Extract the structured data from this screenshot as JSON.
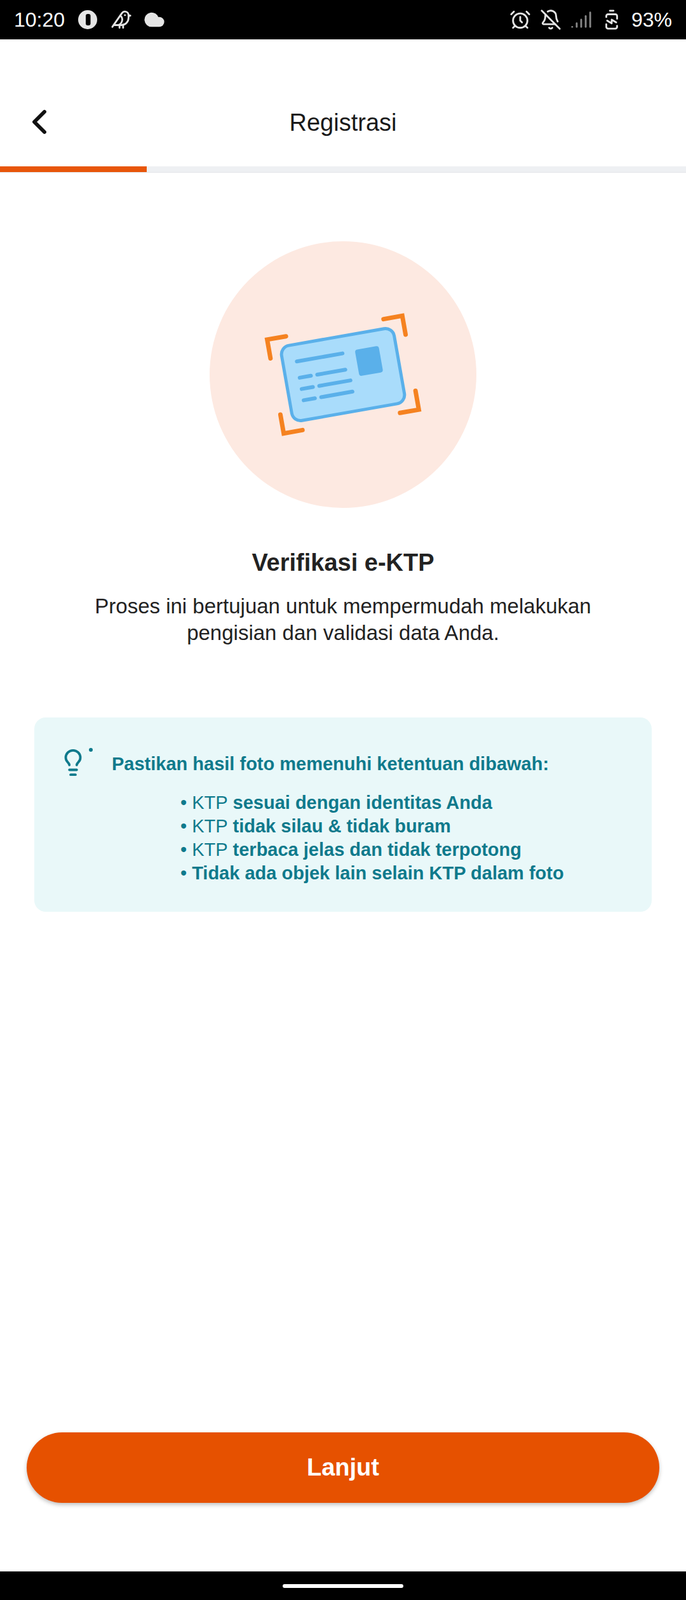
{
  "status_bar": {
    "time": "10:20",
    "battery": "93%"
  },
  "header": {
    "title": "Registrasi"
  },
  "progress": {
    "level": 0.214
  },
  "section": {
    "title": "Verifikasi e-KTP",
    "description": "Proses ini bertujuan untuk mempermudah melakukan pengisian dan validasi data Anda."
  },
  "tips": {
    "heading": "Pastikan hasil foto memenuhi ketentuan dibawah:",
    "bullet": "•",
    "items": [
      {
        "prefix": "KTP",
        "text": "sesuai dengan identitas Anda"
      },
      {
        "prefix": "KTP",
        "text": "tidak silau & tidak buram"
      },
      {
        "prefix": "KTP",
        "text": "terbaca jelas dan tidak terpotong"
      },
      {
        "prefix": "",
        "text": "Tidak ada objek lain selain KTP dalam foto"
      }
    ]
  },
  "buttons": [
    "Lanjut"
  ]
}
